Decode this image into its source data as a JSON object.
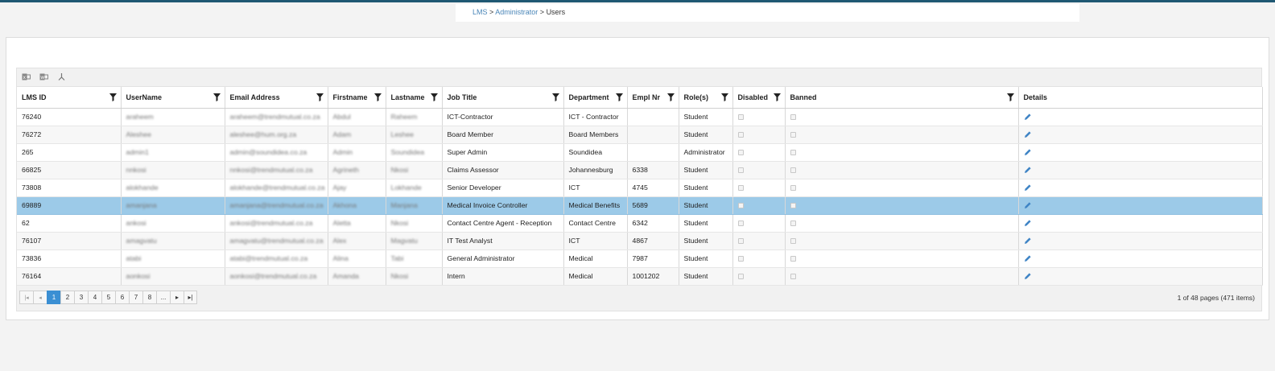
{
  "breadcrumb": {
    "root": "LMS",
    "section": "Administrator",
    "current": "Users",
    "sep": " > "
  },
  "toolbar": {
    "icons": [
      "excel-export-icon",
      "word-export-icon",
      "pdf-export-icon"
    ]
  },
  "columns": [
    "LMS ID",
    "UserName",
    "Email Address",
    "Firstname",
    "Lastname",
    "Job Title",
    "Department",
    "Empl Nr",
    "Role(s)",
    "Disabled",
    "Banned",
    "Details"
  ],
  "rows": [
    {
      "id": "76240",
      "username": "araheem",
      "email": "araheem@trendmutual.co.za",
      "first": "Abdul",
      "last": "Raheem",
      "job": "ICT-Contractor",
      "dept": "ICT - Contractor",
      "empl": "",
      "role": "Student"
    },
    {
      "id": "76272",
      "username": "Aleshee",
      "email": "aleshee@hum.org.za",
      "first": "Adam",
      "last": "Leshee",
      "job": "Board Member",
      "dept": "Board Members",
      "empl": "",
      "role": "Student"
    },
    {
      "id": "265",
      "username": "admin1",
      "email": "admin@soundidea.co.za",
      "first": "Admin",
      "last": "Soundidea",
      "job": "Super Admin",
      "dept": "Soundidea",
      "empl": "",
      "role": "Administrator"
    },
    {
      "id": "66825",
      "username": "nnkosi",
      "email": "nnkosi@trendmutual.co.za",
      "first": "Agrineth",
      "last": "Nkosi",
      "job": "Claims Assessor",
      "dept": "Johannesburg",
      "empl": "6338",
      "role": "Student"
    },
    {
      "id": "73808",
      "username": "alokhande",
      "email": "alokhande@trendmutual.co.za",
      "first": "Ajay",
      "last": "Lokhande",
      "job": "Senior Developer",
      "dept": "ICT",
      "empl": "4745",
      "role": "Student"
    },
    {
      "id": "69889",
      "username": "amanjana",
      "email": "amanjana@trendmutual.co.za",
      "first": "Akhona",
      "last": "Manjana",
      "job": "Medical Invoice Controller",
      "dept": "Medical Benefits",
      "empl": "5689",
      "role": "Student"
    },
    {
      "id": "62",
      "username": "ankosi",
      "email": "ankosi@trendmutual.co.za",
      "first": "Aletta",
      "last": "Nkosi",
      "job": "Contact Centre Agent - Reception",
      "dept": "Contact Centre",
      "empl": "6342",
      "role": "Student"
    },
    {
      "id": "76107",
      "username": "amagvatu",
      "email": "amagvatu@trendmutual.co.za",
      "first": "Alex",
      "last": "Magvatu",
      "job": "IT Test Analyst",
      "dept": "ICT",
      "empl": "4867",
      "role": "Student"
    },
    {
      "id": "73836",
      "username": "atabi",
      "email": "atabi@trendmutual.co.za",
      "first": "Alina",
      "last": "Tabi",
      "job": "General Administrator",
      "dept": "Medical",
      "empl": "7987",
      "role": "Student"
    },
    {
      "id": "76164",
      "username": "aonkosi",
      "email": "aonkosi@trendmutual.co.za",
      "first": "Amanda",
      "last": "Nkosi",
      "job": "Intern",
      "dept": "Medical",
      "empl": "1001202",
      "role": "Student"
    }
  ],
  "selected_row": 5,
  "pager": {
    "first": "|◂",
    "prev": "◂",
    "pages": [
      "1",
      "2",
      "3",
      "4",
      "5",
      "6",
      "7",
      "8",
      "..."
    ],
    "next": "▸",
    "last": "▸|",
    "current": "1",
    "info": "1 of 48 pages (471 items)"
  },
  "colors": {
    "accent": "#3b8fd3",
    "selected_row": "#9ccae8",
    "topbar": "#1f5873",
    "link": "#4a86b8"
  }
}
